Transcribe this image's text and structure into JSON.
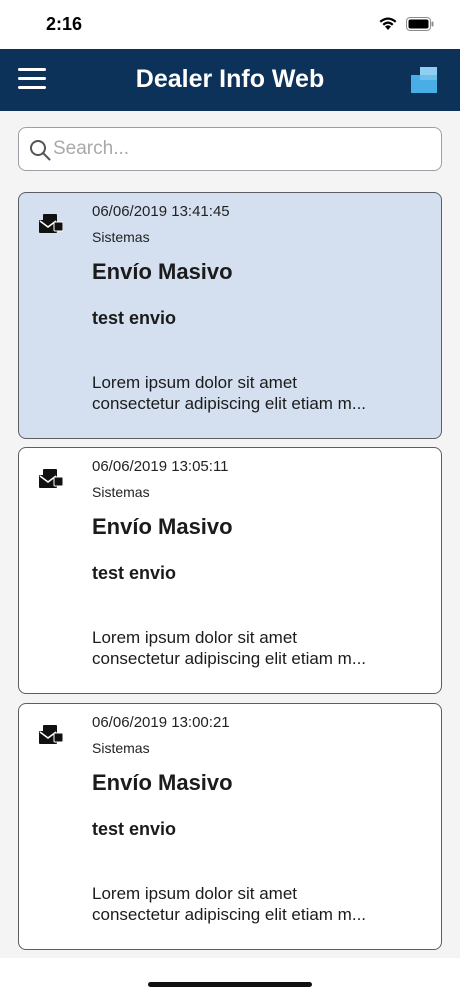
{
  "status": {
    "time": "2:16"
  },
  "header": {
    "title": "Dealer Info Web"
  },
  "search": {
    "placeholder": "Search...",
    "value": ""
  },
  "messages": [
    {
      "date": "06/06/2019 13:41:45",
      "department": "Sistemas",
      "title": "Envío Masivo",
      "subject": "test envio",
      "body_line1": "Lorem ipsum dolor sit amet",
      "body_line2": "consectetur adipiscing elit etiam m...",
      "selected": true
    },
    {
      "date": "06/06/2019 13:05:11",
      "department": "Sistemas",
      "title": "Envío Masivo",
      "subject": "test envio",
      "body_line1": "Lorem ipsum dolor sit amet",
      "body_line2": "consectetur adipiscing elit etiam m...",
      "selected": false
    },
    {
      "date": "06/06/2019 13:00:21",
      "department": "Sistemas",
      "title": "Envío Masivo",
      "subject": "test envio",
      "body_line1": "Lorem ipsum dolor sit amet",
      "body_line2": "consectetur adipiscing elit etiam m...",
      "selected": false
    }
  ],
  "colors": {
    "app_bar": "#0c3259",
    "selected_card": "#d4e0f0",
    "logo_light": "#8fd0f2",
    "logo_dark": "#4aaee6"
  },
  "icons": {
    "menu": "hamburger-menu-icon",
    "logo": "app-logo-icon",
    "search": "search-icon",
    "message": "message-envelope-icon"
  }
}
